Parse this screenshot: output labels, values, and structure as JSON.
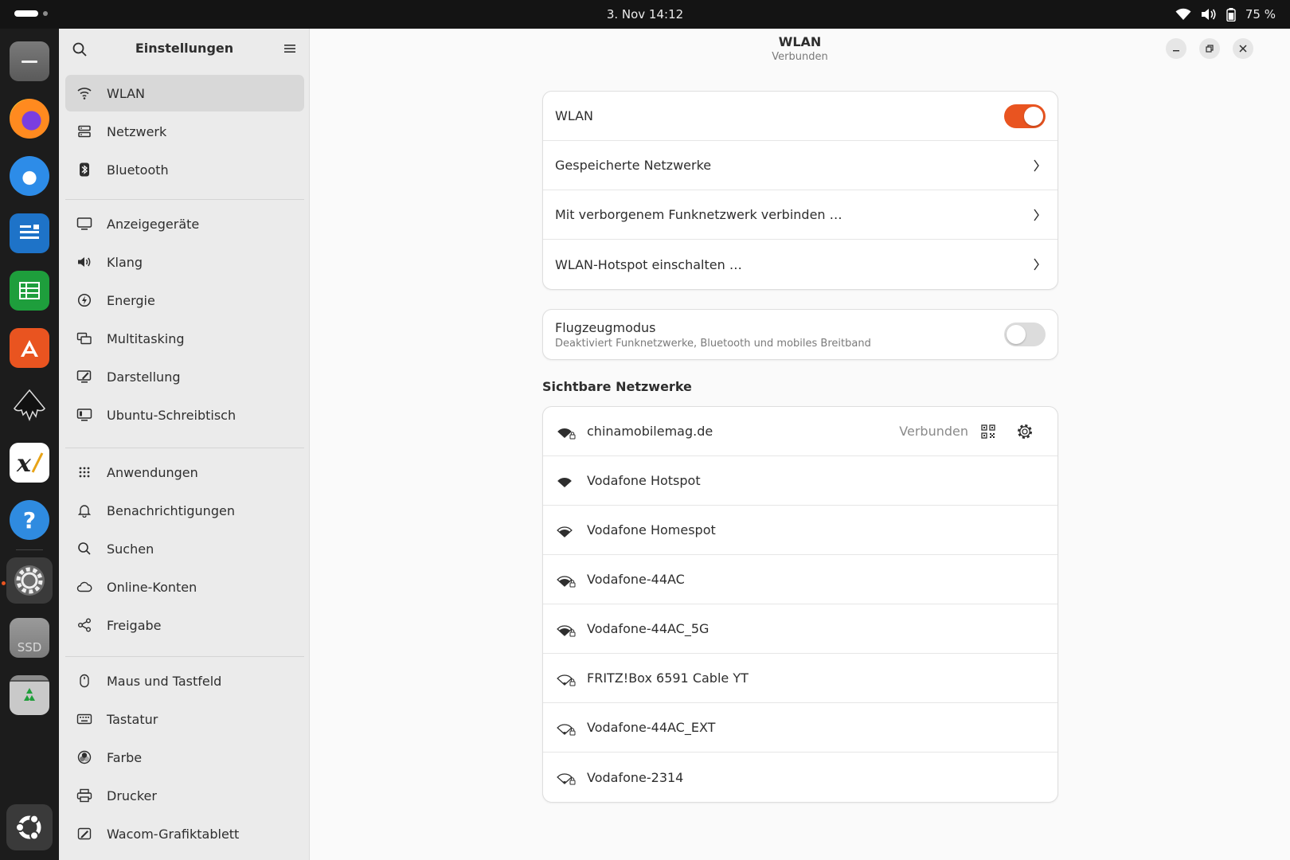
{
  "topbar": {
    "clock": "3. Nov  14:12",
    "battery": "75 %",
    "icons": [
      "wifi-icon",
      "volume-icon",
      "battery-icon"
    ]
  },
  "dock": {
    "apps": [
      "files",
      "firefox",
      "thunderbird",
      "libreoffice-writer",
      "libreoffice-calc",
      "app-center",
      "inkscape",
      "xournal",
      "help",
      "settings",
      "ssd-drive",
      "trash",
      "show-apps"
    ],
    "ssd_label": "SSD",
    "active": "settings"
  },
  "sidebar": {
    "title": "Einstellungen",
    "groups": [
      [
        {
          "label": "WLAN",
          "icon": "wifi-icon",
          "selected": true
        },
        {
          "label": "Netzwerk",
          "icon": "network-icon"
        },
        {
          "label": "Bluetooth",
          "icon": "bluetooth-icon"
        }
      ],
      [
        {
          "label": "Anzeigegeräte",
          "icon": "display-icon"
        },
        {
          "label": "Klang",
          "icon": "speaker-icon"
        },
        {
          "label": "Energie",
          "icon": "power-icon"
        },
        {
          "label": "Multitasking",
          "icon": "multitasking-icon"
        },
        {
          "label": "Darstellung",
          "icon": "appearance-icon"
        },
        {
          "label": "Ubuntu-Schreibtisch",
          "icon": "desktop-icon"
        }
      ],
      [
        {
          "label": "Anwendungen",
          "icon": "apps-grid-icon"
        },
        {
          "label": "Benachrichtigungen",
          "icon": "bell-icon"
        },
        {
          "label": "Suchen",
          "icon": "search-icon"
        },
        {
          "label": "Online-Konten",
          "icon": "cloud-icon"
        },
        {
          "label": "Freigabe",
          "icon": "share-icon"
        }
      ],
      [
        {
          "label": "Maus und Tastfeld",
          "icon": "mouse-icon"
        },
        {
          "label": "Tastatur",
          "icon": "keyboard-icon"
        },
        {
          "label": "Farbe",
          "icon": "color-icon"
        },
        {
          "label": "Drucker",
          "icon": "printer-icon"
        },
        {
          "label": "Wacom-Grafiktablett",
          "icon": "tablet-icon"
        }
      ]
    ]
  },
  "header": {
    "title": "WLAN",
    "subtitle": "Verbunden"
  },
  "wlan_card": {
    "wlan_label": "WLAN",
    "wlan_enabled": true,
    "saved_networks": "Gespeicherte Netzwerke",
    "hidden_network": "Mit verborgenem Funknetzwerk verbinden …",
    "hotspot": "WLAN-Hotspot einschalten …"
  },
  "airplane_card": {
    "title": "Flugzeugmodus",
    "description": "Deaktiviert Funknetzwerke, Bluetooth und mobiles Breitband",
    "enabled": false
  },
  "visible_networks": {
    "heading": "Sichtbare Netzwerke",
    "connected_label": "Verbunden",
    "items": [
      {
        "ssid": "chinamobilemag.de",
        "signal": 4,
        "secured": true,
        "connected": true
      },
      {
        "ssid": "Vodafone Hotspot",
        "signal": 4,
        "secured": false
      },
      {
        "ssid": "Vodafone Homespot",
        "signal": 3,
        "secured": false
      },
      {
        "ssid": "Vodafone-44AC",
        "signal": 3,
        "secured": true
      },
      {
        "ssid": "Vodafone-44AC_5G",
        "signal": 3,
        "secured": true
      },
      {
        "ssid": "FRITZ!Box 6591 Cable YT",
        "signal": 1,
        "secured": true
      },
      {
        "ssid": "Vodafone-44AC_EXT",
        "signal": 1,
        "secured": true
      },
      {
        "ssid": "Vodafone-2314",
        "signal": 1,
        "secured": true
      }
    ]
  },
  "colors": {
    "accent": "#e95420",
    "topbar_bg": "#141414",
    "dock_bg": "#1c1c1c",
    "sidebar_bg": "#ebebeb",
    "content_bg": "#fafafa"
  }
}
